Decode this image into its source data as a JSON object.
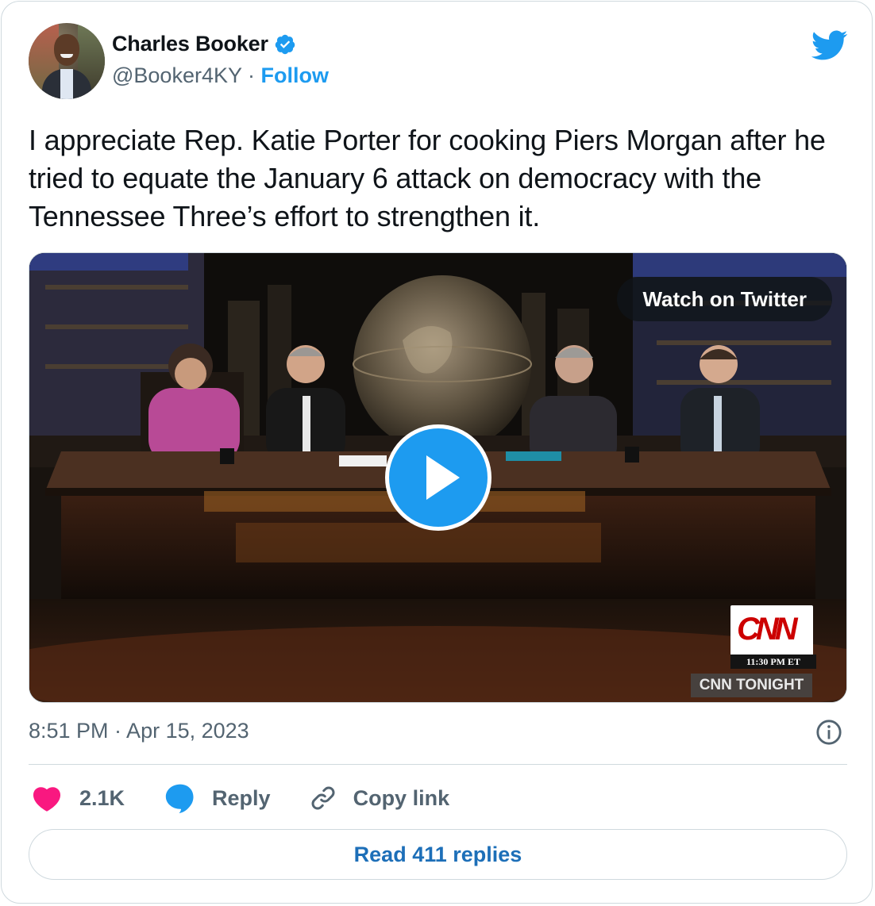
{
  "author": {
    "name": "Charles Booker",
    "handle": "@Booker4KY",
    "separator": "·",
    "follow_label": "Follow",
    "verified": true
  },
  "tweet": {
    "text": "I appreciate Rep. Katie Porter for cooking Piers Morgan after he tried to equate the January 6 attack on democracy with the Tennessee Three’s effort to strengthen it.",
    "timestamp": "8:51 PM · Apr 15, 2023"
  },
  "media": {
    "watch_label": "Watch on Twitter",
    "overlay": {
      "network": "CNN",
      "time": "11:30 PM ET",
      "show": "CNN TONIGHT"
    }
  },
  "actions": {
    "like_count": "2.1K",
    "reply_label": "Reply",
    "copy_label": "Copy link"
  },
  "read_replies_label": "Read 411 replies",
  "icons": {
    "brand": "twitter-bird-icon",
    "verified": "verified-badge-icon",
    "play": "play-icon",
    "info": "info-icon",
    "like": "heart-icon",
    "reply": "speech-bubble-icon",
    "copy": "link-icon"
  },
  "colors": {
    "brand_blue": "#1d9bf0",
    "like_pink": "#f91880",
    "text_primary": "#0f1419",
    "text_secondary": "#536471",
    "border": "#cfd9de",
    "cnn_red": "#cc0000"
  }
}
